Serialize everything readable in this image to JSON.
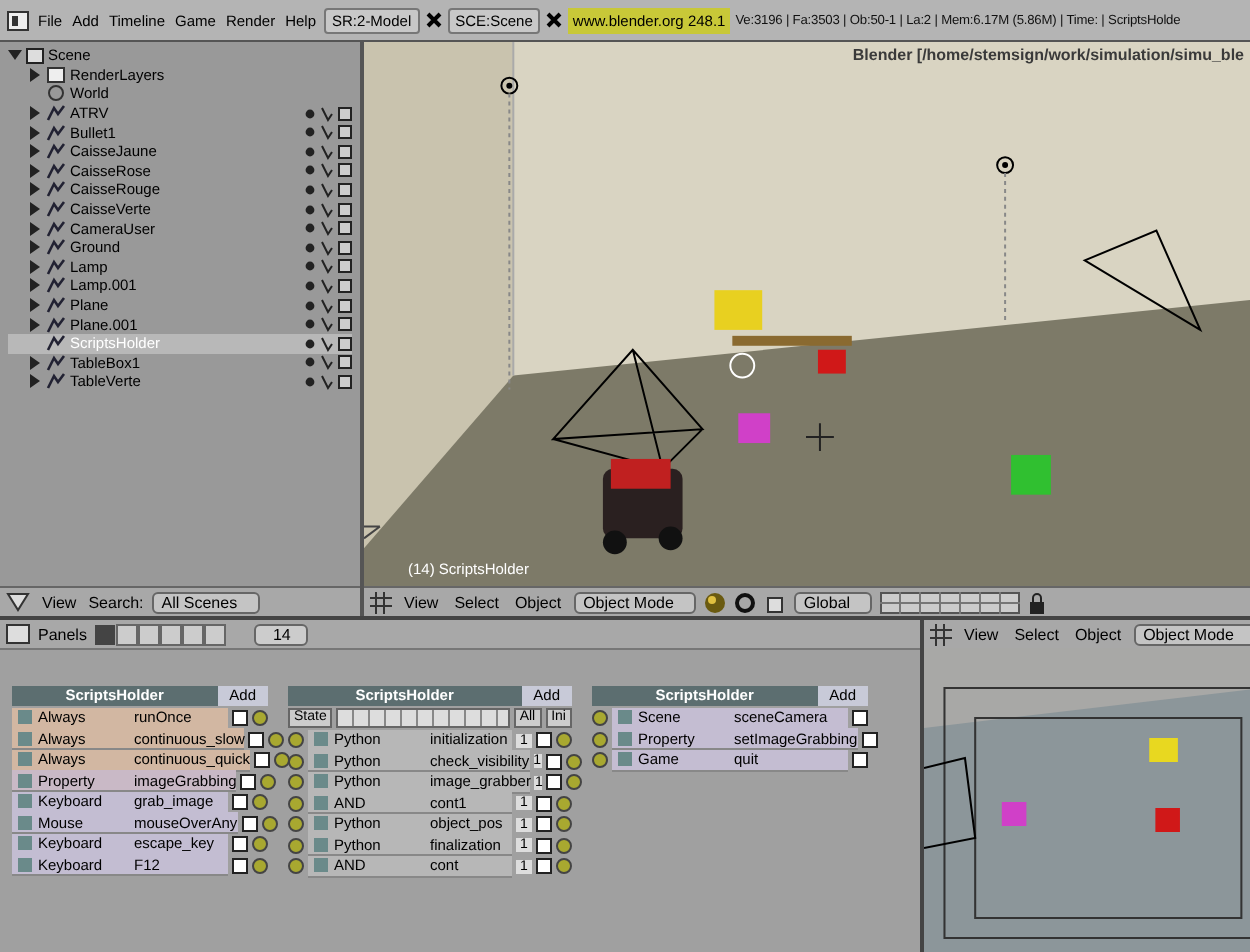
{
  "topbar": {
    "menus": [
      "File",
      "Add",
      "Timeline",
      "Game",
      "Render",
      "Help"
    ],
    "screen": "SR:2-Model",
    "scene": "SCE:Scene",
    "version": "www.blender.org 248.1",
    "stats": "Ve:3196 | Fa:3503 | Ob:50-1 | La:2 | Mem:6.17M (5.86M) | Time: | ScriptsHolde"
  },
  "outliner": {
    "root": {
      "label": "Scene",
      "expanded": true,
      "children": [
        {
          "label": "RenderLayers",
          "kind": "layers",
          "expandable": true,
          "selected": false
        },
        {
          "label": "World",
          "kind": "world",
          "expandable": false,
          "selected": false
        },
        {
          "label": "ATRV",
          "kind": "object",
          "expandable": true,
          "selected": false
        },
        {
          "label": "Bullet1",
          "kind": "object",
          "expandable": true,
          "selected": false
        },
        {
          "label": "CaisseJaune",
          "kind": "object",
          "expandable": true,
          "selected": false
        },
        {
          "label": "CaisseRose",
          "kind": "object",
          "expandable": true,
          "selected": false
        },
        {
          "label": "CaisseRouge",
          "kind": "object",
          "expandable": true,
          "selected": false
        },
        {
          "label": "CaisseVerte",
          "kind": "object",
          "expandable": true,
          "selected": false
        },
        {
          "label": "CameraUser",
          "kind": "object",
          "expandable": true,
          "selected": false
        },
        {
          "label": "Ground",
          "kind": "object",
          "expandable": true,
          "selected": false
        },
        {
          "label": "Lamp",
          "kind": "object",
          "expandable": true,
          "selected": false
        },
        {
          "label": "Lamp.001",
          "kind": "object",
          "expandable": true,
          "selected": false
        },
        {
          "label": "Plane",
          "kind": "object",
          "expandable": true,
          "selected": false
        },
        {
          "label": "Plane.001",
          "kind": "object",
          "expandable": true,
          "selected": false
        },
        {
          "label": "ScriptsHolder",
          "kind": "object",
          "expandable": false,
          "selected": true
        },
        {
          "label": "TableBox1",
          "kind": "object",
          "expandable": true,
          "selected": false
        },
        {
          "label": "TableVerte",
          "kind": "object",
          "expandable": true,
          "selected": false
        }
      ]
    },
    "header": {
      "menus": [
        "View"
      ],
      "search_label": "Search:",
      "search_value": "All Scenes"
    }
  },
  "viewport": {
    "title": "Blender [/home/stemsign/work/simulation/simu_ble",
    "object_label": "(14) ScriptsHolder",
    "header": {
      "menus": [
        "View",
        "Select",
        "Object"
      ],
      "mode": "Object Mode",
      "orientation": "Global"
    }
  },
  "logic": {
    "header": {
      "label": "Panels",
      "frame": "14"
    },
    "sensors": {
      "title": "ScriptsHolder",
      "add": "Add",
      "rows": [
        {
          "type": "Always",
          "name": "runOnce",
          "color": "#d2b7a2"
        },
        {
          "type": "Always",
          "name": "continuous_slow",
          "color": "#d2b7a2"
        },
        {
          "type": "Always",
          "name": "continuous_quick",
          "color": "#d2b7a2"
        },
        {
          "type": "Property",
          "name": "imageGrabbing",
          "color": "#c9b9c6"
        },
        {
          "type": "Keyboard",
          "name": "grab_image",
          "color": "#c3bdd2"
        },
        {
          "type": "Mouse",
          "name": "mouseOverAny",
          "color": "#c3bdd2"
        },
        {
          "type": "Keyboard",
          "name": "escape_key",
          "color": "#c3bdd2"
        },
        {
          "type": "Keyboard",
          "name": "F12",
          "color": "#c3bdd2"
        }
      ]
    },
    "controllers": {
      "title": "ScriptsHolder",
      "add": "Add",
      "state": "State",
      "all": "All",
      "ini": "Ini",
      "rows": [
        {
          "type": "Python",
          "name": "initialization",
          "count": "1"
        },
        {
          "type": "Python",
          "name": "check_visibility",
          "count": "1"
        },
        {
          "type": "Python",
          "name": "image_grabber",
          "count": "1"
        },
        {
          "type": "AND",
          "name": "cont1",
          "count": "1"
        },
        {
          "type": "Python",
          "name": "object_pos",
          "count": "1"
        },
        {
          "type": "Python",
          "name": "finalization",
          "count": "1"
        },
        {
          "type": "AND",
          "name": "cont",
          "count": "1"
        }
      ]
    },
    "actuators": {
      "title": "ScriptsHolder",
      "add": "Add",
      "rows": [
        {
          "type": "Scene",
          "name": "sceneCamera"
        },
        {
          "type": "Property",
          "name": "setImageGrabbing"
        },
        {
          "type": "Game",
          "name": "quit"
        }
      ]
    }
  },
  "preview": {
    "header": {
      "menus": [
        "View",
        "Select",
        "Object"
      ],
      "mode": "Object Mode"
    }
  }
}
